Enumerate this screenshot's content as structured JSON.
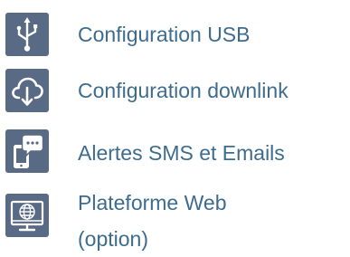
{
  "features": [
    {
      "icon": "usb-icon",
      "label": "Configuration USB"
    },
    {
      "icon": "cloud-download-icon",
      "label": "Configuration downlink"
    },
    {
      "icon": "phone-chat-icon",
      "label": "Alertes SMS et Emails"
    },
    {
      "icon": "web-monitor-icon",
      "label": "Plateforme Web\n(option)"
    }
  ],
  "colors": {
    "icon_bg": "#596a84",
    "text": "#3d6c8e"
  }
}
